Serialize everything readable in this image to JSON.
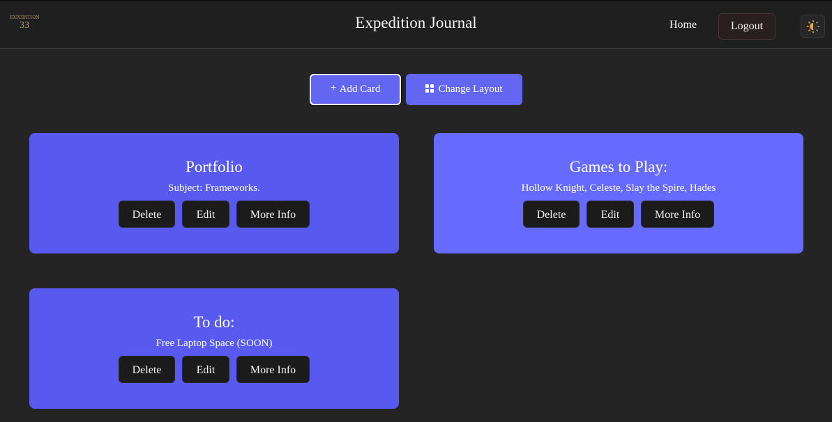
{
  "header": {
    "logo_line1": "EXPEDITION",
    "logo_line2": "33",
    "title": "Expedition Journal",
    "nav_home": "Home",
    "nav_logout": "Logout",
    "theme_icon": "sun-moon-icon"
  },
  "toolbar": {
    "add_card_label": "Add Card",
    "add_card_icon": "plus-icon",
    "change_layout_label": "Change Layout",
    "change_layout_icon": "grid-icon"
  },
  "colors": {
    "accent": "#6366f1",
    "card": "#5759ef",
    "card_alt": "#666aff",
    "background": "#242424",
    "button_dark": "#1b1b1b"
  },
  "cards": [
    {
      "title": "Portfolio",
      "subject": "Subject: Frameworks.",
      "delete_label": "Delete",
      "edit_label": "Edit",
      "info_label": "More Info"
    },
    {
      "title": "Games to Play:",
      "subject": "Hollow Knight, Celeste, Slay the Spire, Hades",
      "delete_label": "Delete",
      "edit_label": "Edit",
      "info_label": "More Info"
    },
    {
      "title": "To do:",
      "subject": "Free Laptop Space (SOON)",
      "delete_label": "Delete",
      "edit_label": "Edit",
      "info_label": "More Info"
    }
  ]
}
